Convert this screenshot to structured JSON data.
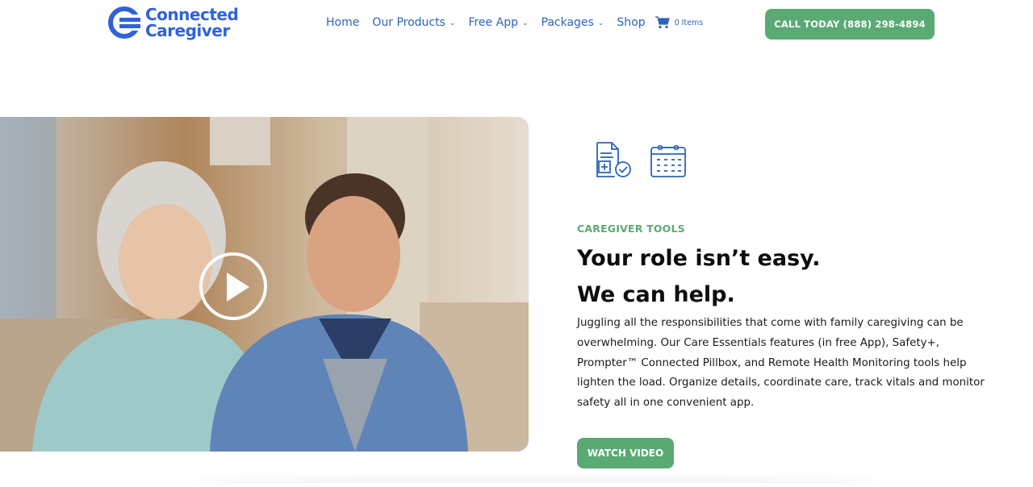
{
  "brand": {
    "line1": "Connected",
    "line2": "Caregiver",
    "color": "#2e63d9"
  },
  "nav": {
    "items": [
      {
        "label": "Home",
        "has_dropdown": false
      },
      {
        "label": "Our Products",
        "has_dropdown": true
      },
      {
        "label": "Free App",
        "has_dropdown": true
      },
      {
        "label": "Packages",
        "has_dropdown": true
      },
      {
        "label": "Shop",
        "has_dropdown": false
      }
    ],
    "cart_icon": "shopping-cart-icon",
    "cart_count": "0 Items",
    "color": "#2e63b8"
  },
  "cta": {
    "label": "CALL TODAY (888) 298-4894",
    "color": "#5aaa73"
  },
  "hero": {
    "play_icon": "play-icon"
  },
  "icons": [
    "medical-document-check-icon",
    "calendar-icon"
  ],
  "section": {
    "eyebrow": "CAREGIVER TOOLS",
    "heading_line1": "Your role isn’t easy.",
    "heading_line2": "We can help.",
    "body": "Juggling all the responsibilities that come with family caregiving can be overwhelming. Our Care Essentials features (in free App), Safety+, Prompter™ Connected Pillbox, and Remote Health Monitoring tools help lighten the load. Organize details, coordinate care, track vitals and monitor safety all in one convenient app.",
    "button_label": "WATCH VIDEO",
    "accent": "#5aaa73"
  }
}
